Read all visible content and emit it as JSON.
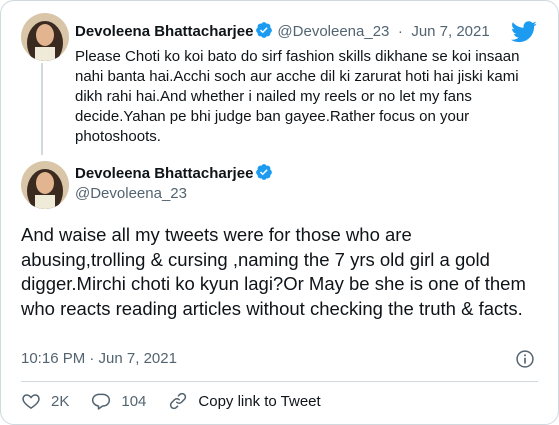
{
  "colors": {
    "verified": "#1d9bf0",
    "twitter_blue": "#1d9bf0",
    "muted": "#536471",
    "text": "#0f1419",
    "border": "#cfd9de"
  },
  "reply_tweet": {
    "author_name": "Devoleena Bhattacharjee",
    "handle": "@Devoleena_23",
    "separator": "·",
    "date": "Jun 7, 2021",
    "text": "Please Choti ko koi bato do sirf fashion skills dikhane se koi insaan nahi banta hai.Acchi soch aur acche dil ki zarurat hoti hai jiski kami dikh rahi hai.And whether i nailed my reels or no let my fans decide.Yahan pe bhi judge ban gayee.Rather focus on your photoshoots."
  },
  "main_tweet": {
    "author_name": "Devoleena Bhattacharjee",
    "handle": "@Devoleena_23",
    "text": "And waise all my tweets were for those who are abusing,trolling & cursing ,naming the 7 yrs old girl a gold digger.Mirchi choti ko kyun lagi?Or May be she is one of them who reacts reading articles without checking the truth & facts.",
    "timestamp": "10:16 PM · Jun 7, 2021"
  },
  "actions": {
    "likes": "2K",
    "replies": "104",
    "copy_link": "Copy link to Tweet"
  },
  "icons": [
    "avatar",
    "verified-badge-icon",
    "twitter-bird-icon",
    "info-icon",
    "heart-icon",
    "reply-icon",
    "link-icon"
  ]
}
